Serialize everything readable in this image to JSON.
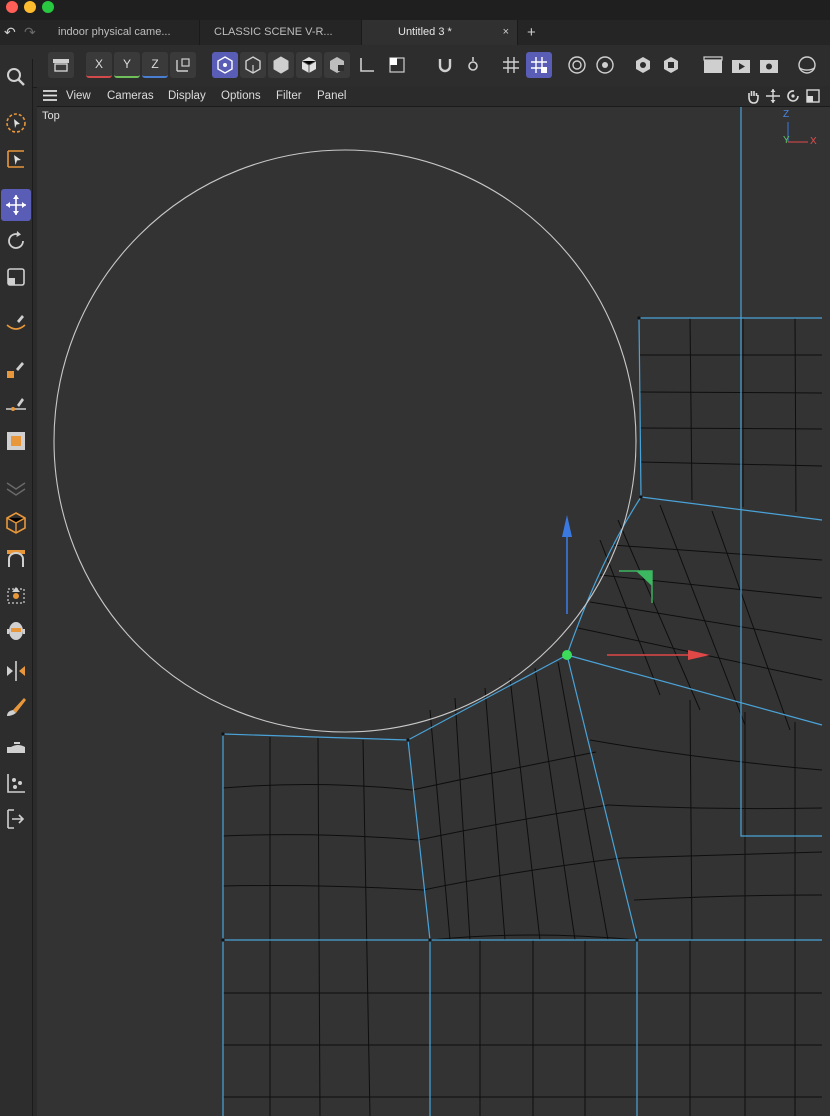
{
  "window": {
    "traffic_lights": {
      "close_color": "#ff5f57",
      "minimize_color": "#febc2e",
      "maximize_color": "#28c840"
    }
  },
  "tabs": [
    {
      "label": "indoor physical came...",
      "active": false
    },
    {
      "label": "CLASSIC SCENE V-R...",
      "active": false
    },
    {
      "label": "Untitled 3 *",
      "active": true,
      "close_glyph": "×"
    }
  ],
  "new_tab_glyph": "+",
  "toolbar": {
    "axis_labels": {
      "x": "X",
      "y": "Y",
      "z": "Z"
    },
    "accent_color": "#5a5db5"
  },
  "view_menu": {
    "items": [
      "View",
      "Cameras",
      "Display",
      "Options",
      "Filter",
      "Panel"
    ]
  },
  "viewport": {
    "label": "Top",
    "axis_gizmo": {
      "z": "Z",
      "y": "Y",
      "x": "X"
    },
    "colors": {
      "background": "#333333",
      "mesh_wire": "#111111",
      "mesh_edge": "#4aa3d8",
      "circle_spline": "#c8c8c8",
      "x_axis": "#e04848",
      "y_axis": "#3a7ae0",
      "selected_point": "#3cdc5a"
    }
  }
}
